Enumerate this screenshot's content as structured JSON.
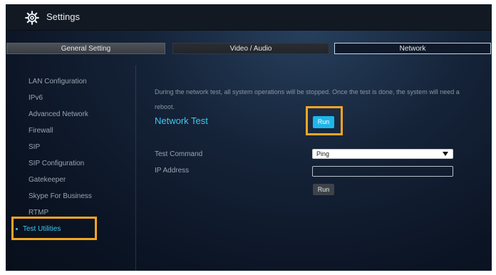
{
  "app": {
    "title": "Settings"
  },
  "tabs": [
    {
      "label": "General Setting"
    },
    {
      "label": "Video / Audio"
    },
    {
      "label": "Network"
    }
  ],
  "sidebar": {
    "items": [
      {
        "label": "LAN Configuration"
      },
      {
        "label": "IPv6"
      },
      {
        "label": "Advanced Network"
      },
      {
        "label": "Firewall"
      },
      {
        "label": "SIP"
      },
      {
        "label": "SIP Configuration"
      },
      {
        "label": "Gatekeeper"
      },
      {
        "label": "Skype For Business"
      },
      {
        "label": "RTMP"
      },
      {
        "label": "Test Utilities"
      }
    ]
  },
  "content": {
    "description": "During the network test, all system operations will be stopped. Once the test is done, the system will need a reboot.",
    "network_test_label": "Network Test",
    "run_label": "Run",
    "test_command_label": "Test Command",
    "test_command_value": "Ping",
    "ip_address_label": "IP Address",
    "ip_address_value": "",
    "run_command_label": "Run"
  },
  "colors": {
    "accent": "#3fc8f0",
    "highlight": "#f5a623",
    "run_button": "#1fb6ea"
  }
}
